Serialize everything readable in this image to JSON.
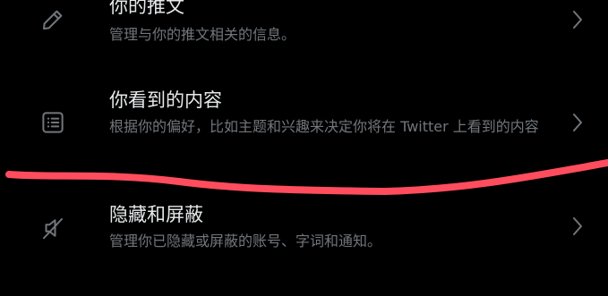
{
  "settings": {
    "items": [
      {
        "id": "your-tweets",
        "title": "你的推文",
        "description": "管理与你的推文相关的信息。",
        "icon": "pencil-icon"
      },
      {
        "id": "content-you-see",
        "title": "你看到的内容",
        "description": "根据你的偏好，比如主题和兴趣来决定你将在 Twitter 上看到的内容",
        "icon": "list-icon"
      },
      {
        "id": "mute-and-block",
        "title": "隐藏和屏蔽",
        "description": "管理你已隐藏或屏蔽的账号、字词和通知。",
        "icon": "muted-speaker-icon"
      }
    ]
  },
  "colors": {
    "background": "#000000",
    "title": "#e7e9ea",
    "secondary": "#71767b",
    "annotation_stroke": "#ff4d5e"
  }
}
